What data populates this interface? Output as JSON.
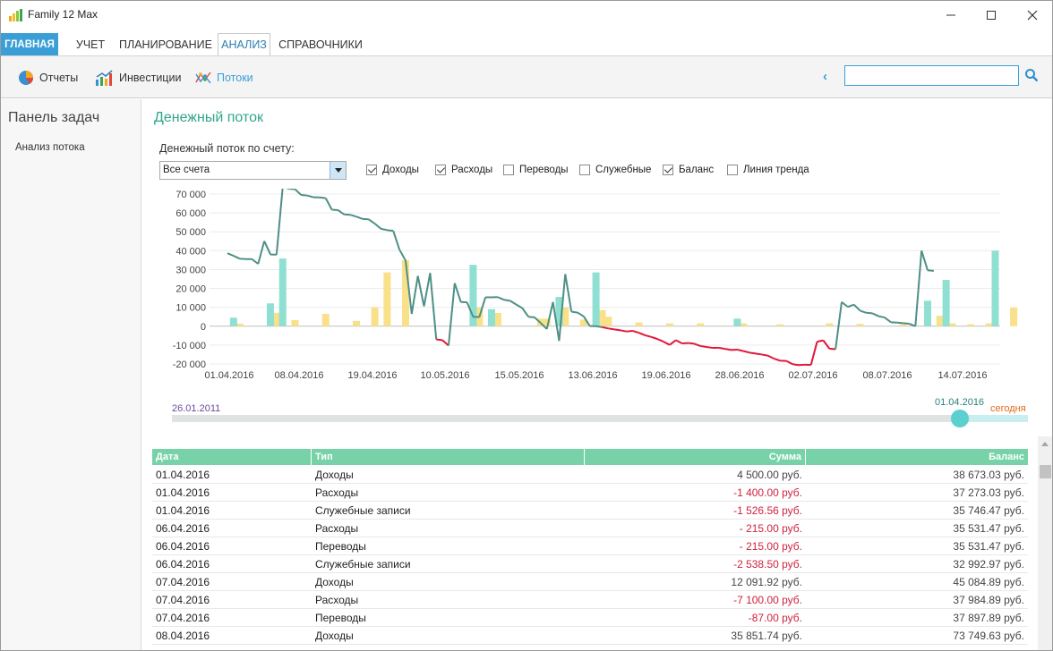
{
  "window": {
    "title": "Family 12 Max"
  },
  "tabs": [
    {
      "label": "ГЛАВНАЯ"
    },
    {
      "label": "УЧЕТ"
    },
    {
      "label": "ПЛАНИРОВАНИЕ"
    },
    {
      "label": "АНАЛИЗ"
    },
    {
      "label": "СПРАВОЧНИКИ"
    }
  ],
  "toolbar": {
    "reports": "Отчеты",
    "investments": "Инвестиции",
    "flows": "Потоки"
  },
  "search": {
    "value": "",
    "placeholder": ""
  },
  "left_panel": {
    "title": "Панель задач",
    "item": "Анализ потока"
  },
  "main": {
    "title": "Денежный поток",
    "account_label": "Денежный поток по счету:",
    "account_value": "Все счета",
    "filters": [
      {
        "label": "Доходы",
        "checked": true
      },
      {
        "label": "Расходы",
        "checked": true
      },
      {
        "label": "Переводы",
        "checked": false
      },
      {
        "label": "Служебные",
        "checked": false
      },
      {
        "label": "Баланс",
        "checked": true
      },
      {
        "label": "Линия тренда",
        "checked": false
      }
    ]
  },
  "timeline": {
    "start": "26.01.2011",
    "current": "01.04.2016",
    "end": "сегодня",
    "position": 0.92
  },
  "chart_data": {
    "type": "line",
    "title": "",
    "xlabel": "",
    "ylabel": "",
    "ylim": [
      -20000,
      70000
    ],
    "yticks": [
      -20000,
      -10000,
      0,
      10000,
      20000,
      30000,
      40000,
      50000,
      60000,
      70000
    ],
    "ytick_labels": [
      "-20 000",
      "-10 000",
      "0",
      "10 000",
      "20 000",
      "30 000",
      "40 000",
      "50 000",
      "60 000",
      "70 000"
    ],
    "xtick_labels": [
      "01.04.2016",
      "08.04.2016",
      "19.04.2016",
      "10.05.2016",
      "15.05.2016",
      "13.06.2016",
      "19.06.2016",
      "28.06.2016",
      "02.07.2016",
      "08.07.2016",
      "14.07.2016"
    ],
    "grid": true,
    "colors": {
      "income": "#8fe0d2",
      "expense": "#f9e08a",
      "balance_pos": "#4e8f86",
      "balance_neg": "#e0173a"
    },
    "income_bars": [
      [
        1,
        4500
      ],
      [
        7,
        12092
      ],
      [
        9,
        35852
      ],
      [
        40,
        32500
      ],
      [
        43,
        9000
      ],
      [
        54,
        15500
      ],
      [
        60,
        28500
      ],
      [
        83,
        4000
      ],
      [
        114,
        13500
      ],
      [
        117,
        24500
      ],
      [
        125,
        40000
      ]
    ],
    "expense_bars": [
      [
        2,
        1400
      ],
      [
        8,
        7100
      ],
      [
        11,
        3200
      ],
      [
        16,
        6500
      ],
      [
        21,
        2800
      ],
      [
        24,
        10000
      ],
      [
        26,
        28500
      ],
      [
        29,
        35000
      ],
      [
        41,
        10000
      ],
      [
        44,
        7000
      ],
      [
        51,
        4000
      ],
      [
        52,
        4000
      ],
      [
        55,
        10000
      ],
      [
        58,
        3500
      ],
      [
        61,
        8500
      ],
      [
        62,
        5000
      ],
      [
        67,
        2000
      ],
      [
        72,
        1500
      ],
      [
        77,
        1500
      ],
      [
        84,
        1500
      ],
      [
        90,
        1000
      ],
      [
        98,
        1500
      ],
      [
        103,
        1200
      ],
      [
        110,
        1000
      ],
      [
        116,
        5500
      ],
      [
        118,
        1500
      ],
      [
        121,
        1000
      ],
      [
        124,
        1500
      ],
      [
        128,
        10000
      ]
    ],
    "balance": [
      [
        0,
        38673
      ],
      [
        1,
        37273
      ],
      [
        2,
        35746
      ],
      [
        3,
        35531
      ],
      [
        4,
        35531
      ],
      [
        5,
        32993
      ],
      [
        6,
        45085
      ],
      [
        7,
        37985
      ],
      [
        8,
        37898
      ],
      [
        9,
        73750
      ],
      [
        10,
        72800
      ],
      [
        11,
        72600
      ],
      [
        12,
        69500
      ],
      [
        13,
        69200
      ],
      [
        14,
        68300
      ],
      [
        15,
        68200
      ],
      [
        16,
        67800
      ],
      [
        17,
        61700
      ],
      [
        18,
        61500
      ],
      [
        19,
        59200
      ],
      [
        20,
        59000
      ],
      [
        21,
        58000
      ],
      [
        22,
        56800
      ],
      [
        23,
        56600
      ],
      [
        24,
        54300
      ],
      [
        25,
        51600
      ],
      [
        26,
        50900
      ],
      [
        27,
        50500
      ],
      [
        28,
        40600
      ],
      [
        29,
        34800
      ],
      [
        30,
        6500
      ],
      [
        31,
        26600
      ],
      [
        32,
        10500
      ],
      [
        33,
        28200
      ],
      [
        34,
        -7000
      ],
      [
        35,
        -7400
      ],
      [
        36,
        -10300
      ],
      [
        37,
        22800
      ],
      [
        38,
        12800
      ],
      [
        39,
        12700
      ],
      [
        40,
        5000
      ],
      [
        41,
        4800
      ],
      [
        42,
        15300
      ],
      [
        43,
        15300
      ],
      [
        44,
        15400
      ],
      [
        45,
        14000
      ],
      [
        46,
        13500
      ],
      [
        47,
        11500
      ],
      [
        48,
        9600
      ],
      [
        49,
        5000
      ],
      [
        50,
        4700
      ],
      [
        51,
        1700
      ],
      [
        52,
        -1500
      ],
      [
        53,
        12800
      ],
      [
        54,
        -7800
      ],
      [
        55,
        27600
      ],
      [
        56,
        7700
      ],
      [
        57,
        7200
      ],
      [
        58,
        5200
      ],
      [
        59,
        100
      ],
      [
        60,
        0
      ],
      [
        61,
        -500
      ],
      [
        62,
        -1200
      ],
      [
        63,
        -1700
      ],
      [
        64,
        -2200
      ],
      [
        65,
        -2800
      ],
      [
        66,
        -2500
      ],
      [
        67,
        -3500
      ],
      [
        68,
        -4800
      ],
      [
        69,
        -5700
      ],
      [
        70,
        -6800
      ],
      [
        71,
        -8200
      ],
      [
        72,
        -9900
      ],
      [
        73,
        -7400
      ],
      [
        74,
        -9100
      ],
      [
        75,
        -8900
      ],
      [
        76,
        -9300
      ],
      [
        77,
        -10500
      ],
      [
        78,
        -11000
      ],
      [
        79,
        -11500
      ],
      [
        80,
        -11400
      ],
      [
        81,
        -12000
      ],
      [
        82,
        -12600
      ],
      [
        83,
        -12400
      ],
      [
        84,
        -13200
      ],
      [
        85,
        -14000
      ],
      [
        86,
        -14500
      ],
      [
        87,
        -15000
      ],
      [
        88,
        -15600
      ],
      [
        89,
        -17200
      ],
      [
        90,
        -18300
      ],
      [
        91,
        -18400
      ],
      [
        92,
        -20100
      ],
      [
        93,
        -20600
      ],
      [
        94,
        -20400
      ],
      [
        95,
        -20500
      ],
      [
        96,
        -8200
      ],
      [
        97,
        -7500
      ],
      [
        98,
        -11900
      ],
      [
        99,
        -12200
      ],
      [
        100,
        12800
      ],
      [
        101,
        10200
      ],
      [
        102,
        11400
      ],
      [
        103,
        8200
      ],
      [
        104,
        7100
      ],
      [
        105,
        6800
      ],
      [
        106,
        5300
      ],
      [
        107,
        4600
      ],
      [
        108,
        2100
      ],
      [
        109,
        1900
      ],
      [
        110,
        1600
      ],
      [
        111,
        1300
      ],
      [
        112,
        0
      ],
      [
        113,
        40000
      ],
      [
        114,
        29600
      ],
      [
        115,
        29300
      ]
    ]
  },
  "table": {
    "headers": [
      "Дата",
      "Тип",
      "Сумма",
      "Баланс"
    ],
    "rows": [
      {
        "date": "01.04.2016",
        "type": "Доходы",
        "sum": "4 500.00 руб.",
        "balance": "38 673.03 руб.",
        "neg": false
      },
      {
        "date": "01.04.2016",
        "type": "Расходы",
        "sum": "-1 400.00 руб.",
        "balance": "37 273.03 руб.",
        "neg": true
      },
      {
        "date": "01.04.2016",
        "type": "Служебные записи",
        "sum": "-1 526.56 руб.",
        "balance": "35 746.47 руб.",
        "neg": true
      },
      {
        "date": "06.04.2016",
        "type": "Расходы",
        "sum": "- 215.00 руб.",
        "balance": "35 531.47 руб.",
        "neg": true
      },
      {
        "date": "06.04.2016",
        "type": "Переводы",
        "sum": "- 215.00 руб.",
        "balance": "35 531.47 руб.",
        "neg": true
      },
      {
        "date": "06.04.2016",
        "type": "Служебные записи",
        "sum": "-2 538.50 руб.",
        "balance": "32 992.97 руб.",
        "neg": true
      },
      {
        "date": "07.04.2016",
        "type": "Доходы",
        "sum": "12 091.92 руб.",
        "balance": "45 084.89 руб.",
        "neg": false
      },
      {
        "date": "07.04.2016",
        "type": "Расходы",
        "sum": "-7 100.00 руб.",
        "balance": "37 984.89 руб.",
        "neg": true
      },
      {
        "date": "07.04.2016",
        "type": "Переводы",
        "sum": "-87.00 руб.",
        "balance": "37 897.89 руб.",
        "neg": true
      },
      {
        "date": "08.04.2016",
        "type": "Доходы",
        "sum": "35 851.74 руб.",
        "balance": "73 749.63 руб.",
        "neg": false
      }
    ]
  }
}
